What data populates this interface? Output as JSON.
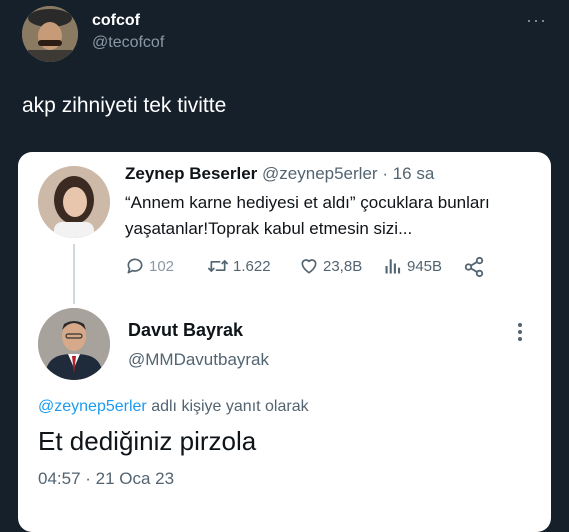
{
  "top": {
    "display_name": "cofcof",
    "handle": "@tecofcof",
    "more": "···",
    "text": "akp zihniyeti tek tivitte"
  },
  "quoted": {
    "display_name": "Zeynep Beserler",
    "handle": "@zeynep5erler",
    "separator": "·",
    "time": "16 sa",
    "text": "“Annem karne hediyesi et aldı” çocuklara bunları yaşatanlar!Toprak kabul etmesin sizi...",
    "metrics": {
      "replies": "102",
      "retweets": "1.622",
      "likes": "23,8B",
      "views": "945B"
    }
  },
  "reply": {
    "display_name": "Davut Bayrak",
    "handle": "@MMDavutbayrak",
    "reply_to_handle": "@zeynep5erler",
    "reply_to_suffix": " adlı kişiye yanıt olarak",
    "text": "Et dediğiniz pirzola",
    "timestamp": "04:57 · 21 Oca 23"
  },
  "icons": [
    "reply-icon",
    "retweet-icon",
    "like-icon",
    "views-icon",
    "share-icon",
    "more-icon"
  ],
  "colors": {
    "background": "#15202b",
    "card": "#ffffff",
    "accent_link": "#1d9bf0",
    "muted_text": "#536471"
  }
}
